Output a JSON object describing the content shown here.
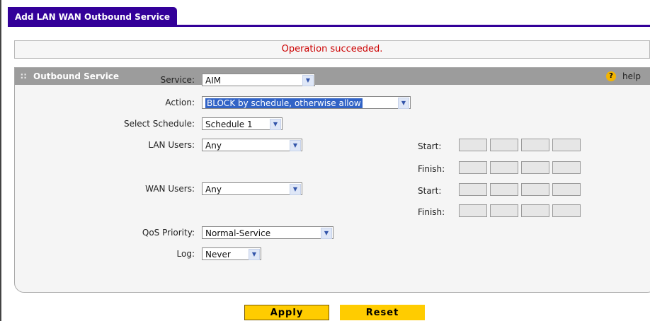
{
  "tab": {
    "title": "Add LAN WAN Outbound Service"
  },
  "status": {
    "message": "Operation succeeded."
  },
  "panel": {
    "title": "Outbound Service",
    "help_label": "help"
  },
  "form": {
    "service": {
      "label": "Service:",
      "value": "AIM"
    },
    "action": {
      "label": "Action:",
      "value": "BLOCK by schedule, otherwise allow"
    },
    "schedule": {
      "label": "Select Schedule:",
      "value": "Schedule 1"
    },
    "lan_users": {
      "label": "LAN Users:",
      "value": "Any"
    },
    "wan_users": {
      "label": "WAN Users:",
      "value": "Any"
    },
    "qos": {
      "label": "QoS Priority:",
      "value": "Normal-Service"
    },
    "log": {
      "label": "Log:",
      "value": "Never"
    }
  },
  "ranges": {
    "start_label": "Start:",
    "finish_label": "Finish:"
  },
  "buttons": {
    "apply": "Apply",
    "reset": "Reset"
  },
  "colors": {
    "tab": "#330099",
    "status_text": "#cc0000",
    "button": "#ffcc00",
    "panel_header": "#9c9c9c"
  }
}
